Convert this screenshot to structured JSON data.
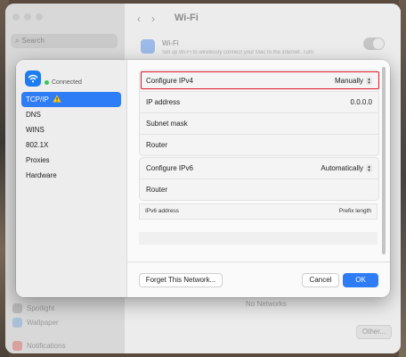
{
  "background_window": {
    "sidebar": {
      "search_placeholder": "Search",
      "items": [
        {
          "label": "Spotlight"
        },
        {
          "label": "Wallpaper"
        },
        {
          "label": "Notifications"
        }
      ]
    },
    "title": "Wi-Fi",
    "wifi": {
      "name": "Wi-Fi",
      "description": "Set up Wi-Fi to wirelessly connect your Mac to the internet. Turn"
    },
    "no_networks": "No Networks",
    "other_button": "Other..."
  },
  "sheet": {
    "status": "Connected",
    "tabs": [
      {
        "label": "TCP/IP",
        "selected": true,
        "warning": true
      },
      {
        "label": "DNS"
      },
      {
        "label": "WINS"
      },
      {
        "label": "802.1X"
      },
      {
        "label": "Proxies"
      },
      {
        "label": "Hardware"
      }
    ],
    "ipv4": {
      "configure_label": "Configure IPv4",
      "configure_value": "Manually",
      "ip_label": "IP address",
      "ip_value": "0.0.0.0",
      "subnet_label": "Subnet mask",
      "router_label": "Router"
    },
    "ipv6": {
      "configure_label": "Configure IPv6",
      "configure_value": "Automatically",
      "router_label": "Router",
      "table_col1": "IPv6 address",
      "table_col2": "Prefix length"
    },
    "buttons": {
      "forget": "Forget This Network...",
      "cancel": "Cancel",
      "ok": "OK"
    },
    "colors": {
      "accent": "#2e7cf6",
      "highlight": "#e0182d",
      "connected": "#34c759"
    }
  }
}
